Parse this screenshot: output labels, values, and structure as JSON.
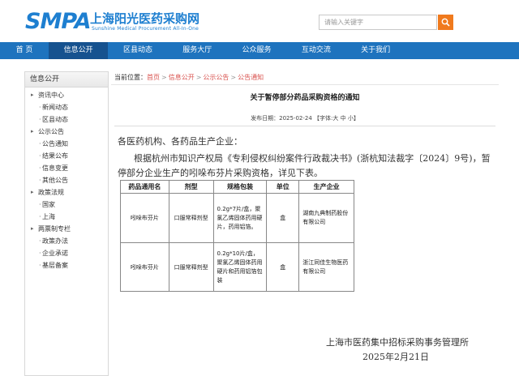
{
  "header": {
    "logo_smpa": "SMPA",
    "logo_cn": "上海阳光医药采购网",
    "logo_en": "Sunshine Medical Procurement All-In-One",
    "search_placeholder": "请输入关键字"
  },
  "nav": {
    "items": [
      "首 页",
      "信息公开",
      "区县动态",
      "服务大厅",
      "公众服务",
      "互动交流",
      "关于我们"
    ],
    "active_index": 1
  },
  "sidebar": {
    "title": "信息公开",
    "items": [
      {
        "label": "资讯中心",
        "level": 1
      },
      {
        "label": "新闻动态",
        "level": 2
      },
      {
        "label": "区县动态",
        "level": 2
      },
      {
        "label": "公示公告",
        "level": 1
      },
      {
        "label": "公告通知",
        "level": 2
      },
      {
        "label": "结果公布",
        "level": 2
      },
      {
        "label": "信息变更",
        "level": 2
      },
      {
        "label": "其他公告",
        "level": 2
      },
      {
        "label": "政策法规",
        "level": 1
      },
      {
        "label": "国家",
        "level": 2
      },
      {
        "label": "上海",
        "level": 2
      },
      {
        "label": "两票制专栏",
        "level": 1
      },
      {
        "label": "政策办法",
        "level": 2
      },
      {
        "label": "企业承诺",
        "level": 2
      },
      {
        "label": "基层备案",
        "level": 2
      }
    ]
  },
  "breadcrumb": {
    "prefix": "当前位置：",
    "items": [
      "首页",
      "信息公开",
      "公示公告",
      "公告通知"
    ]
  },
  "article": {
    "title": "关于暂停部分药品采购资格的通知",
    "meta": "发布日期：2025-02-24 【字体:大 中 小】",
    "greeting": "各医药机构、各药品生产企业：",
    "paragraph": "根据杭州市知识产权局《专利侵权纠纷案件行政裁决书》(浙杭知法裁字〔2024〕9号)，暂停部分企业生产的吲哚布芬片采购资格，详见下表。",
    "table": {
      "headers": [
        "药品通用名",
        "剂型",
        "规格包装",
        "单位",
        "生产企业"
      ],
      "rows": [
        [
          "吲哚布芬片",
          "口服常释剂型",
          "0.2g*7片/盒，聚氯乙烯固体药用硬片，药用铝箔。",
          "盒",
          "湖南九典制药股份有限公司"
        ],
        [
          "吲哚布芬片",
          "口服常释剂型",
          "0.2g*10片/盒，聚氯乙烯固体药用硬片和药用铝箔包装",
          "盒",
          "浙江同佳生物医药有限公司"
        ]
      ]
    },
    "signature_org": "上海市医药集中招标采购事务管理所",
    "signature_date": "2025年2月21日"
  }
}
